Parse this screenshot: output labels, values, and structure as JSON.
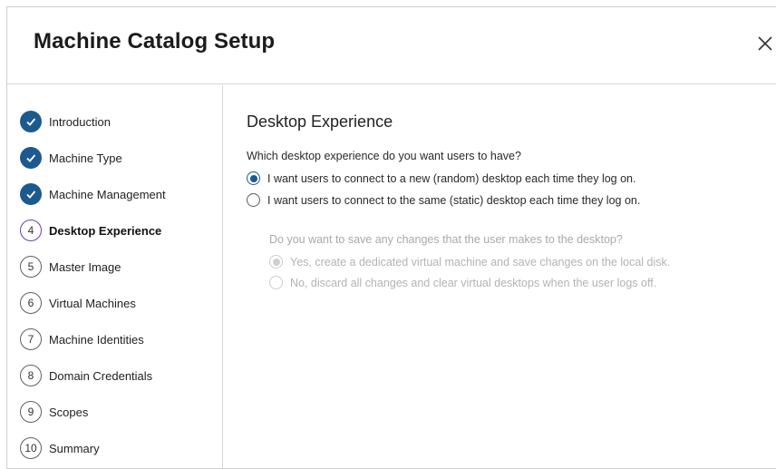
{
  "dialog": {
    "title": "Machine Catalog Setup"
  },
  "steps": [
    {
      "marker": "check",
      "label": "Introduction",
      "state": "done"
    },
    {
      "marker": "check",
      "label": "Machine Type",
      "state": "done"
    },
    {
      "marker": "check",
      "label": "Machine Management",
      "state": "done"
    },
    {
      "marker": "4",
      "label": "Desktop Experience",
      "state": "current"
    },
    {
      "marker": "5",
      "label": "Master Image",
      "state": "pending"
    },
    {
      "marker": "6",
      "label": "Virtual Machines",
      "state": "pending"
    },
    {
      "marker": "7",
      "label": "Machine Identities",
      "state": "pending"
    },
    {
      "marker": "8",
      "label": "Domain Credentials",
      "state": "pending"
    },
    {
      "marker": "9",
      "label": "Scopes",
      "state": "pending"
    },
    {
      "marker": "10",
      "label": "Summary",
      "state": "pending"
    }
  ],
  "content": {
    "section_title": "Desktop Experience",
    "question": "Which desktop experience do you want users to have?",
    "options": [
      {
        "label": "I want users to connect to a new (random) desktop each time they log on.",
        "checked": true
      },
      {
        "label": "I want users to connect to the same (static) desktop each time they log on.",
        "checked": false
      }
    ],
    "sub_question": "Do you want to save any changes that the user makes to the desktop?",
    "sub_options": [
      {
        "label": "Yes, create a dedicated virtual machine and save changes on the local disk.",
        "checked": true,
        "disabled": true
      },
      {
        "label": "No, discard all changes and clear virtual desktops when the user logs off.",
        "checked": false,
        "disabled": true
      }
    ]
  },
  "colors": {
    "accent": "#1c5a8e",
    "current_step": "#6a3fb0",
    "disabled_text": "#b3b3b3"
  }
}
